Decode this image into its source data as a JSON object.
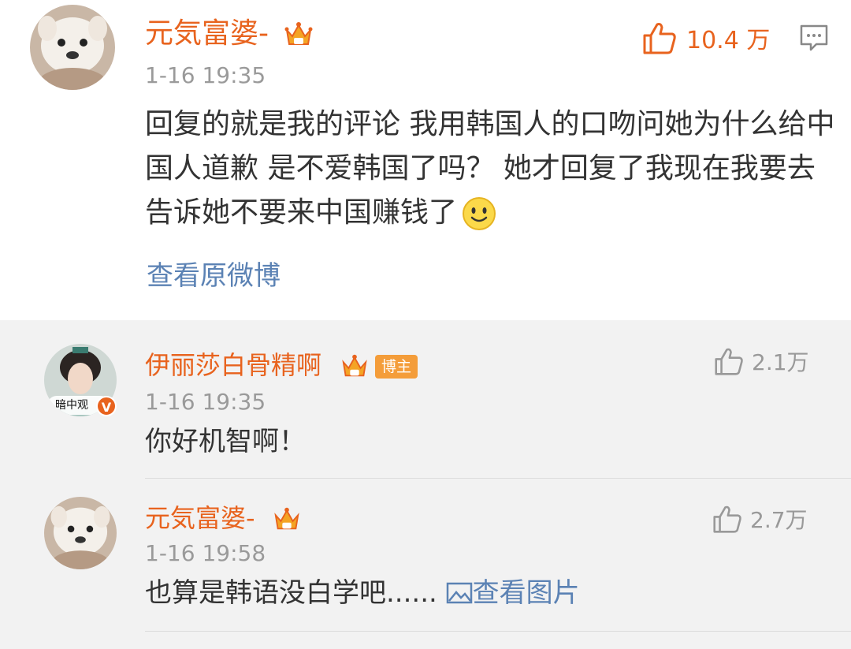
{
  "main_comment": {
    "username": "元気富婆-",
    "time": "1-16 19:35",
    "likes": "10.4 万",
    "text": "回复的就是我的评论 我用韩国人的口吻问她为什么给中国人道歉 是不爱韩国了吗？ 她才回复了我现在我要去告诉她不要来中国赚钱了",
    "view_original": "查看原微博",
    "icons": [
      "crown-icon",
      "thumbs-up-icon",
      "comment-icon",
      "smiley-icon"
    ],
    "accent_color": "#e8631e",
    "link_color": "#5b82b4"
  },
  "replies": [
    {
      "username": "伊丽莎白骨精啊",
      "badge": "博主",
      "avatar_tag": "暗中观",
      "verified": "V",
      "time": "1-16 19:35",
      "likes": "2.1万",
      "text": "你好机智啊！"
    },
    {
      "username": "元気富婆-",
      "time": "1-16 19:58",
      "likes": "2.7万",
      "text": "也算是韩语没白学吧......",
      "view_image": "查看图片"
    }
  ]
}
